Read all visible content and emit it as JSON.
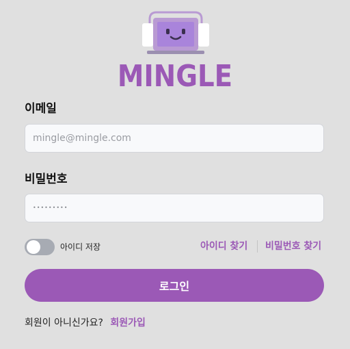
{
  "brand": {
    "name": "MINGLE",
    "icon": "robot-monitor-icon"
  },
  "form": {
    "email_label": "이메일",
    "email_placeholder": "mingle@mingle.com",
    "password_label": "비밀번호",
    "password_value": "•••••••••",
    "remember_label": "아이디 저장",
    "remember_checked": false,
    "find_id_link": "아이디 찾기",
    "find_password_link": "비밀번호 찾기",
    "login_button": "로그인"
  },
  "footer": {
    "signup_prompt": "회원이 아니신가요?",
    "signup_link": "회원가입"
  },
  "colors": {
    "accent": "#9b59b6",
    "background": "#e0e0e0",
    "toggle_off": "#a7abb3"
  }
}
